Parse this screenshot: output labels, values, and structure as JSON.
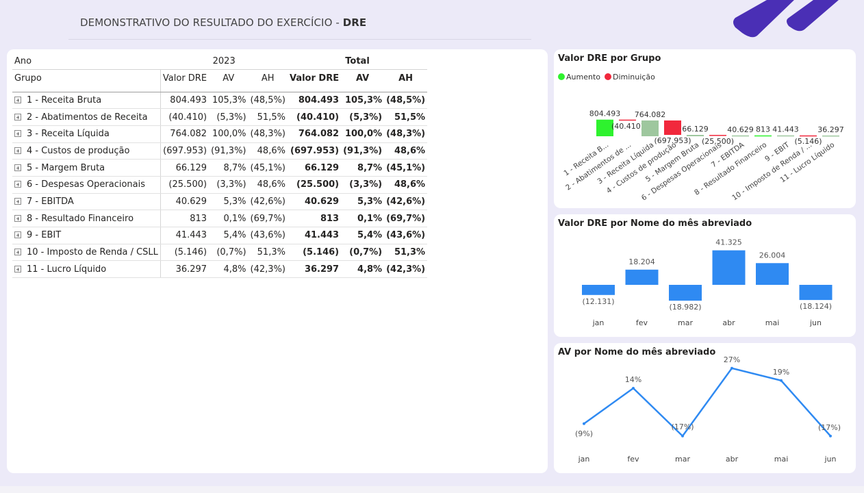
{
  "header": {
    "title_prefix": "DEMONSTRATIVO DO RESULTADO DO EXERCÍCIO - ",
    "title_bold": "DRE"
  },
  "matrix": {
    "col_ano": "Ano",
    "col_year": "2023",
    "col_total": "Total",
    "col_grupo": "Grupo",
    "col_valor": "Valor DRE",
    "col_av": "AV",
    "col_ah": "AH",
    "rows": [
      {
        "grupo": "1 - Receita Bruta",
        "valor": "804.493",
        "av": "105,3%",
        "ah": "(48,5%)",
        "tvalor": "804.493",
        "tav": "105,3%",
        "tah": "(48,5%)"
      },
      {
        "grupo": "2 - Abatimentos de Receita",
        "valor": "(40.410)",
        "av": "(5,3%)",
        "ah": "51,5%",
        "tvalor": "(40.410)",
        "tav": "(5,3%)",
        "tah": "51,5%"
      },
      {
        "grupo": "3 - Receita Líquida",
        "valor": "764.082",
        "av": "100,0%",
        "ah": "(48,3%)",
        "tvalor": "764.082",
        "tav": "100,0%",
        "tah": "(48,3%)"
      },
      {
        "grupo": "4 - Custos de produção",
        "valor": "(697.953)",
        "av": "(91,3%)",
        "ah": "48,6%",
        "tvalor": "(697.953)",
        "tav": "(91,3%)",
        "tah": "48,6%"
      },
      {
        "grupo": "5 - Margem Bruta",
        "valor": "66.129",
        "av": "8,7%",
        "ah": "(45,1%)",
        "tvalor": "66.129",
        "tav": "8,7%",
        "tah": "(45,1%)"
      },
      {
        "grupo": "6 - Despesas Operacionais",
        "valor": "(25.500)",
        "av": "(3,3%)",
        "ah": "48,6%",
        "tvalor": "(25.500)",
        "tav": "(3,3%)",
        "tah": "48,6%"
      },
      {
        "grupo": "7 - EBITDA",
        "valor": "40.629",
        "av": "5,3%",
        "ah": "(42,6%)",
        "tvalor": "40.629",
        "tav": "5,3%",
        "tah": "(42,6%)"
      },
      {
        "grupo": "8 - Resultado Financeiro",
        "valor": "813",
        "av": "0,1%",
        "ah": "(69,7%)",
        "tvalor": "813",
        "tav": "0,1%",
        "tah": "(69,7%)"
      },
      {
        "grupo": "9 - EBIT",
        "valor": "41.443",
        "av": "5,4%",
        "ah": "(43,6%)",
        "tvalor": "41.443",
        "tav": "5,4%",
        "tah": "(43,6%)"
      },
      {
        "grupo": "10 - Imposto de Renda / CSLL",
        "valor": "(5.146)",
        "av": "(0,7%)",
        "ah": "51,3%",
        "tvalor": "(5.146)",
        "tav": "(0,7%)",
        "tah": "51,3%"
      },
      {
        "grupo": "11 - Lucro Líquido",
        "valor": "36.297",
        "av": "4,8%",
        "ah": "(42,3%)",
        "tvalor": "36.297",
        "tav": "4,8%",
        "tah": "(42,3%)"
      }
    ]
  },
  "colors": {
    "increase": "#2ef22e",
    "decrease": "#f1283c",
    "total": "#9ec79e",
    "bar": "#2f8af2",
    "line": "#2f8af2",
    "logo": "#4a2fb5"
  },
  "waterfall": {
    "title": "Valor DRE por Grupo",
    "legend_increase": "Aumento",
    "legend_decrease": "Diminuição"
  },
  "bars": {
    "title": "Valor DRE por Nome do mês abreviado"
  },
  "line": {
    "title": "AV por Nome do mês abreviado"
  },
  "chart_data": [
    {
      "type": "bar",
      "subtype": "waterfall",
      "title": "Valor DRE por Grupo",
      "legend": [
        "Aumento",
        "Diminuição"
      ],
      "categories": [
        "1 - Receita B...",
        "2 - Abatimentos de ...",
        "3 - Receita Líquida",
        "4 - Custos de produção",
        "5 - Margem Bruta",
        "6 - Despesas Operacionais",
        "7 - EBITDA",
        "8 - Resultado Financeiro",
        "9 - EBIT",
        "10 - Imposto de Renda / ...",
        "11 - Lucro Líquido"
      ],
      "values": [
        804493,
        -40410,
        764082,
        -697953,
        66129,
        -25500,
        40629,
        813,
        41443,
        -5146,
        36297
      ],
      "labels": [
        "804.493",
        "(40.410)",
        "764.082",
        "(697.953)",
        "66.129",
        "(25.500)",
        "40.629",
        "813",
        "41.443",
        "(5.146)",
        "36.297"
      ]
    },
    {
      "type": "bar",
      "title": "Valor DRE por Nome do mês abreviado",
      "categories": [
        "jan",
        "fev",
        "mar",
        "abr",
        "mai",
        "jun"
      ],
      "values": [
        -12131,
        18204,
        -18982,
        41325,
        26004,
        -18124
      ],
      "labels": [
        "(12.131)",
        "18.204",
        "(18.982)",
        "41.325",
        "26.004",
        "(18.124)"
      ]
    },
    {
      "type": "line",
      "title": "AV por Nome do mês abreviado",
      "categories": [
        "jan",
        "fev",
        "mar",
        "abr",
        "mai",
        "jun"
      ],
      "values": [
        -9,
        14,
        -17,
        27,
        19,
        -17
      ],
      "labels": [
        "(9%)",
        "14%",
        "(17%)",
        "27%",
        "19%",
        "(17%)"
      ]
    }
  ]
}
